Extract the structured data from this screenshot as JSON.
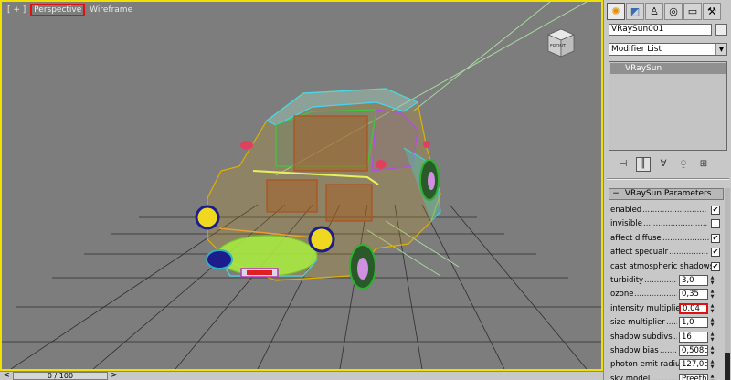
{
  "viewport": {
    "label_plus": "[ + ]",
    "label_active": "Perspective",
    "label_mode": "Wireframe",
    "viewcube_face": "FRONT"
  },
  "timeline": {
    "frame": "0 / 100",
    "prev": "<",
    "next": ">"
  },
  "panel": {
    "tabs": [
      {
        "icon": "sun-create-icon",
        "glyph": "✺"
      },
      {
        "icon": "modify-icon",
        "glyph": "◩"
      },
      {
        "icon": "hierarchy-icon",
        "glyph": "♙"
      },
      {
        "icon": "motion-icon",
        "glyph": "◎"
      },
      {
        "icon": "display-icon",
        "glyph": "▭"
      },
      {
        "icon": "utilities-icon",
        "glyph": "⚒"
      }
    ],
    "object_name": "VRaySun001",
    "object_color": "#ececec",
    "modifier_list": "Modifier List",
    "stack_item": "VRaySun",
    "stack_tools": [
      {
        "icon": "pin-stack-icon",
        "glyph": "⊣"
      },
      {
        "icon": "show-end-result-icon",
        "glyph": "║"
      },
      {
        "icon": "make-unique-icon",
        "glyph": "∀"
      },
      {
        "icon": "remove-modifier-icon",
        "glyph": "⍜"
      },
      {
        "icon": "configure-sets-icon",
        "glyph": "⊞"
      }
    ],
    "rollout": {
      "title": "VRaySun Parameters",
      "minus": "−",
      "params": [
        {
          "label": "enabled",
          "kind": "check",
          "checked": true
        },
        {
          "label": "invisible",
          "kind": "check",
          "checked": false
        },
        {
          "label": "affect diffuse",
          "kind": "check",
          "checked": true
        },
        {
          "label": "affect specualr",
          "kind": "check",
          "checked": true
        },
        {
          "label": "cast atmospheric shadows",
          "kind": "check",
          "checked": true
        },
        {
          "label": "turbidity",
          "kind": "spin",
          "value": "3,0"
        },
        {
          "label": "ozone",
          "kind": "spin",
          "value": "0,35"
        },
        {
          "label": "intensity multiplier",
          "kind": "spin",
          "value": "0,04",
          "highlight": true
        },
        {
          "label": "size multiplier",
          "kind": "spin",
          "value": "1,0"
        },
        {
          "label": "shadow subdivs",
          "kind": "spin",
          "value": "16"
        },
        {
          "label": "shadow bias",
          "kind": "spin",
          "value": "0,508c"
        },
        {
          "label": "photon emit radius",
          "kind": "spin",
          "value": "127,0c"
        },
        {
          "label": "sky model",
          "kind": "spin",
          "value": "Preetham"
        }
      ]
    }
  },
  "colors": {
    "viewport_bg": "#7d7d7d",
    "active_border": "#f0e000",
    "highlight_red": "#e01010"
  }
}
